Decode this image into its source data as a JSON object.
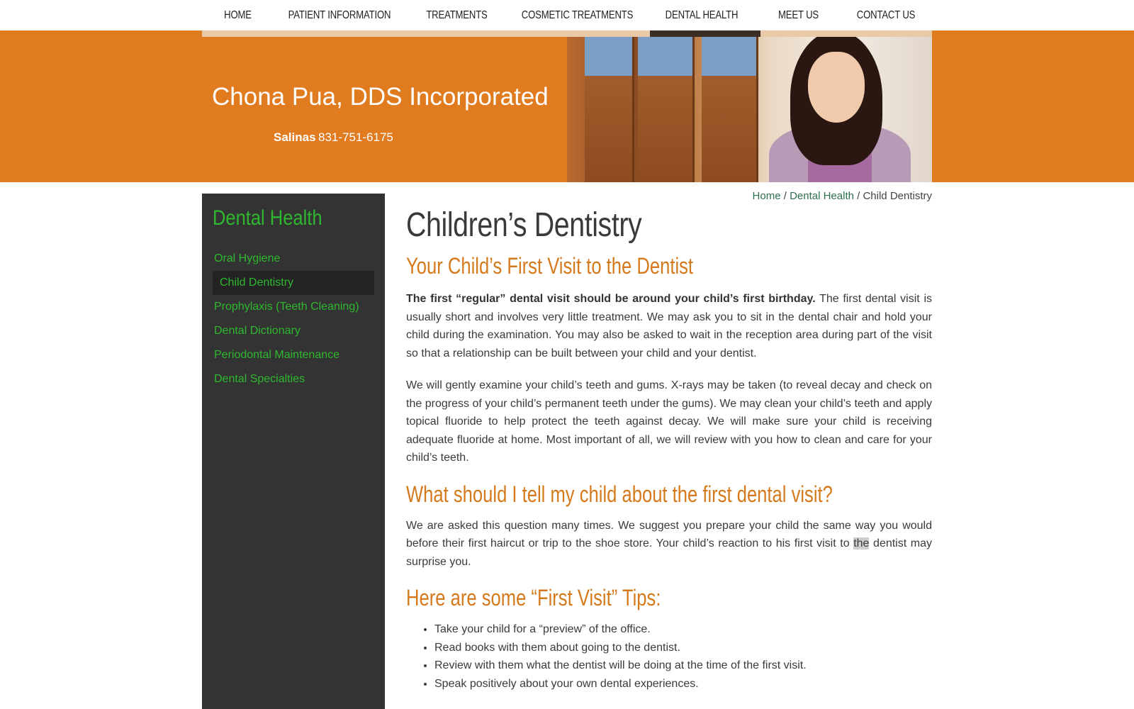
{
  "nav": {
    "items": [
      "HOME",
      "PATIENT INFORMATION",
      "TREATMENTS",
      "COSMETIC TREATMENTS",
      "DENTAL HEALTH",
      "MEET US",
      "CONTACT US"
    ]
  },
  "banner": {
    "title": "Chona Pua, DDS Incorporated",
    "city": "Salinas",
    "phone": "831-751-6175"
  },
  "sidebar": {
    "heading": "Dental Health",
    "items": [
      "Oral Hygiene",
      "Child Dentistry",
      "Prophylaxis (Teeth Cleaning)",
      "Dental Dictionary",
      "Periodontal Maintenance",
      "Dental Specialties"
    ]
  },
  "breadcrumb": {
    "home": "Home",
    "sep1": " / ",
    "section": "Dental Health",
    "sep2": " / ",
    "current": "Child Dentistry"
  },
  "content": {
    "title": "Children’s Dentistry",
    "h1": "Your Child’s First Visit to the Dentist",
    "p1_bold": "The first “regular” dental visit should be around your child’s first birthday.",
    "p1_rest": " The first dental visit is usually short and involves very little treatment. We may ask you to sit in the dental chair and hold your child during the examination. You may also be asked to wait in the reception area during part of the visit so that a relationship can be built between your child and your dentist.",
    "p2": "We will gently examine your child’s teeth and gums. X-rays may be taken (to reveal decay and check on the progress of your child’s permanent teeth under the gums). We may clean your child’s teeth and apply topical fluoride to help protect the teeth against decay. We will make sure your child is receiving adequate fluoride at home. Most important of all, we will review with you how to clean and care for your child’s teeth.",
    "h2": "What should I tell my child about the first dental visit?",
    "p3_a": "We are asked this question many times. We suggest you prepare your child the same way you would before their first haircut or trip to the shoe store. Your child’s reaction to his first visit to ",
    "p3_hl": "the",
    "p3_b": " dentist may surprise you.",
    "h3": "Here are some “First Visit” Tips:",
    "tips": [
      "Take your child for a “preview” of the office.",
      "Read books with them about going to the dentist.",
      "Review with them what the dentist will be doing at the time of the first visit.",
      "Speak positively about your own dental experiences."
    ]
  }
}
